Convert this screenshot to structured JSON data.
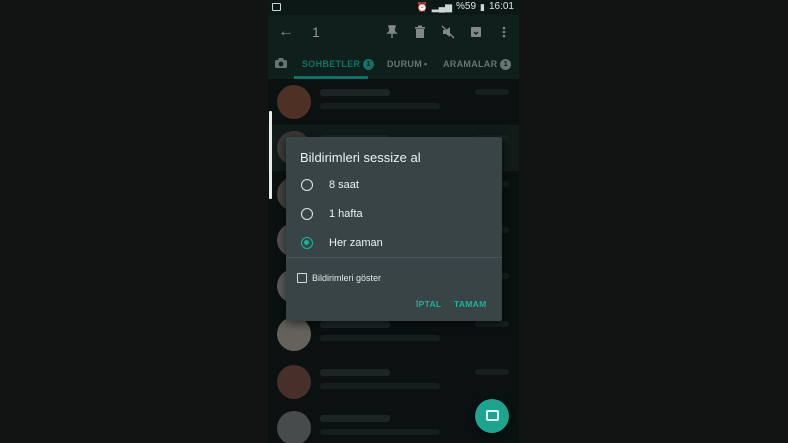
{
  "status_bar": {
    "alarm_icon": "alarm-icon",
    "signal_icon": "signal-icon",
    "battery": "%59",
    "time": "16:01"
  },
  "toolbar": {
    "back_icon": "arrow-back-icon",
    "selected_count": "1",
    "actions": [
      "pin-icon",
      "delete-icon",
      "mute-icon",
      "archive-icon",
      "more-vert-icon"
    ]
  },
  "tabs": {
    "camera_icon": "camera-icon",
    "items": [
      {
        "label": "SOHBETLER",
        "badge": "1",
        "active": true
      },
      {
        "label": "DURUM",
        "badge": "•",
        "active": false
      },
      {
        "label": "ARAMALAR",
        "badge": "1",
        "active": false
      }
    ]
  },
  "dialog": {
    "title": "Bildirimleri sessize al",
    "options": [
      {
        "label": "8 saat",
        "selected": false
      },
      {
        "label": "1 hafta",
        "selected": false
      },
      {
        "label": "Her zaman",
        "selected": true
      }
    ],
    "show_notifications_label": "Bildirimleri göster",
    "show_notifications_checked": false,
    "cancel_label": "İPTAL",
    "ok_label": "TAMAM"
  },
  "fab": {
    "icon": "new-chat-icon"
  },
  "colors": {
    "accent": "#17b39c",
    "dialog_bg": "#384446",
    "toolbar_bg": "#16302b"
  }
}
